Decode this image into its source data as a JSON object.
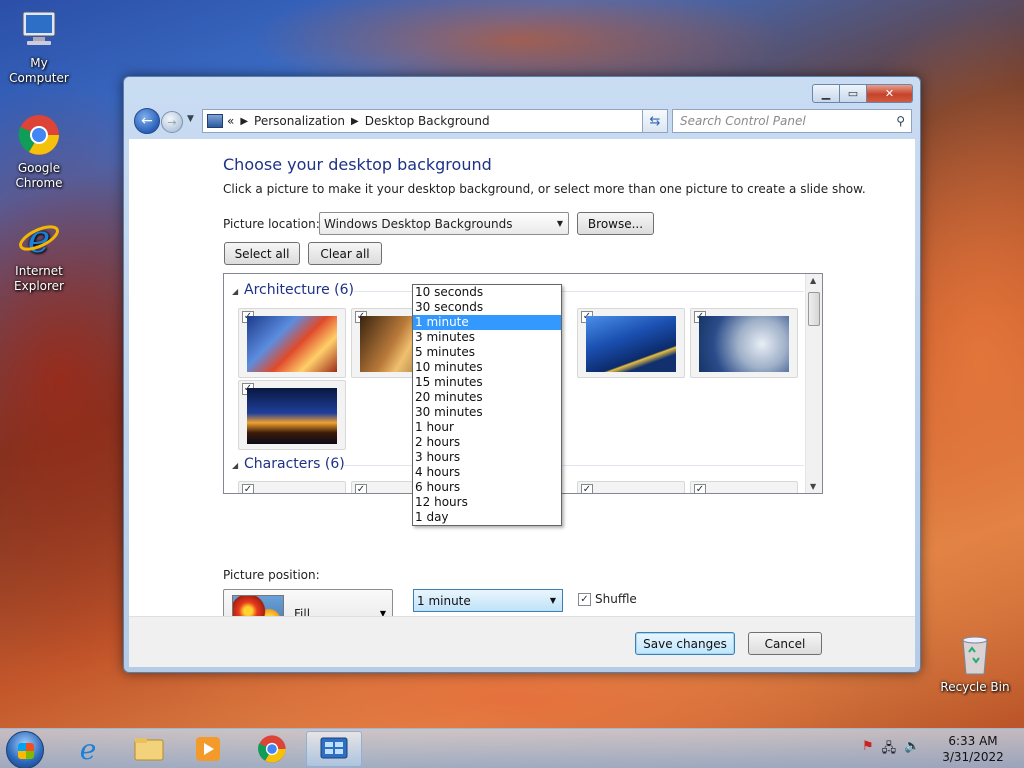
{
  "desktop": {
    "icons": [
      {
        "label": "My Computer"
      },
      {
        "label": "Google Chrome"
      },
      {
        "label": "Internet Explorer"
      },
      {
        "label": "Recycle Bin"
      }
    ]
  },
  "window": {
    "address": {
      "prefix": "«",
      "crumbs": [
        "Personalization",
        "Desktop Background"
      ]
    },
    "search_placeholder": "Search Control Panel",
    "title": "Choose your desktop background",
    "subtitle": "Click a picture to make it your desktop background, or select more than one picture to create a slide show.",
    "picture_location_label": "Picture location:",
    "picture_location_value": "Windows Desktop Backgrounds",
    "browse_label": "Browse...",
    "select_all_label": "Select all",
    "clear_all_label": "Clear all",
    "groups": [
      {
        "name": "Architecture (6)"
      },
      {
        "name": "Characters (6)"
      }
    ],
    "picture_position_label": "Picture position:",
    "picture_position_value": "Fill",
    "interval_value": "1 minute",
    "interval_options": [
      "10 seconds",
      "30 seconds",
      "1 minute",
      "3 minutes",
      "5 minutes",
      "10 minutes",
      "15 minutes",
      "20 minutes",
      "30 minutes",
      "1 hour",
      "2 hours",
      "3 hours",
      "4 hours",
      "6 hours",
      "12 hours",
      "1 day"
    ],
    "interval_selected_index": 2,
    "shuffle_label": "Shuffle",
    "save_label": "Save changes",
    "cancel_label": "Cancel"
  },
  "taskbar": {
    "time": "6:33 AM",
    "date": "3/31/2022"
  },
  "colors": {
    "heading": "#1e3287",
    "selection": "#3399ff"
  }
}
